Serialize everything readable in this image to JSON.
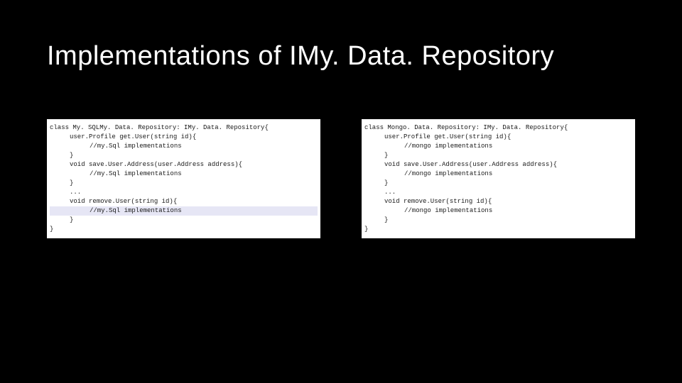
{
  "title": "Implementations of IMy. Data. Repository",
  "left_panel": {
    "lines": [
      "class My. SQLMy. Data. Repository: IMy. Data. Repository{",
      "user.Profile get.User(string id){",
      "//my.Sql implementations",
      "}",
      "void save.User.Address(user.Address address){",
      "//my.Sql implementations",
      "}",
      "...",
      "void remove.User(string id){",
      "//my.Sql implementations",
      "}",
      "}"
    ],
    "highlight_index": 9
  },
  "right_panel": {
    "lines": [
      "class Mongo. Data. Repository: IMy. Data. Repository{",
      "user.Profile get.User(string id){",
      "//mongo implementations",
      "}",
      "void save.User.Address(user.Address address){",
      "//mongo implementations",
      "}",
      "...",
      "void remove.User(string id){",
      "//mongo implementations",
      "}",
      "}"
    ]
  }
}
